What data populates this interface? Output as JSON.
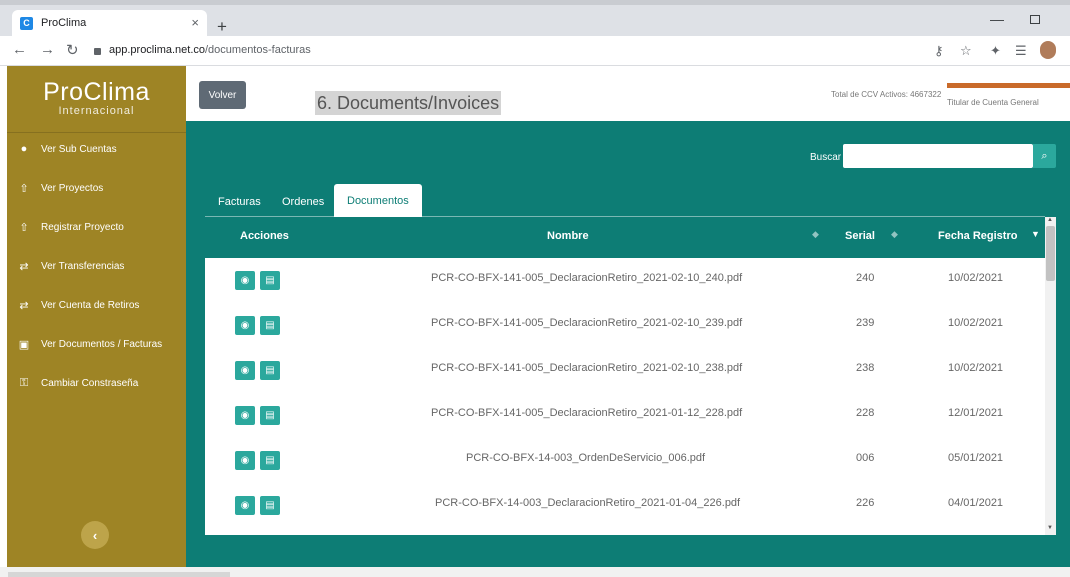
{
  "browser": {
    "tab_title": "ProClima",
    "tab_close": "×",
    "new_tab": "+",
    "url_domain": "app.proclima.net.co",
    "url_path": "/documentos-facturas"
  },
  "sidebar": {
    "logo_main": "ProClima",
    "logo_sub": "Internacional",
    "items": [
      {
        "label": "Ver Sub Cuentas",
        "icon": "group-icon"
      },
      {
        "label": "Ver Proyectos",
        "icon": "upload-icon"
      },
      {
        "label": "Registrar Proyecto",
        "icon": "upload-icon"
      },
      {
        "label": "Ver Transferencias",
        "icon": "transfer-icon"
      },
      {
        "label": "Ver Cuenta de Retiros",
        "icon": "transfer-icon"
      },
      {
        "label": "Ver Documentos / Facturas",
        "icon": "document-icon"
      },
      {
        "label": "Cambiar Constraseña",
        "icon": "key-icon"
      }
    ]
  },
  "header": {
    "back_label": "Volver",
    "title": "6. Documents/Invoices",
    "ccv_total": "Total de CCV Activos: 4667322",
    "user_role": "Titular de Cuenta General"
  },
  "search": {
    "label": "Buscar",
    "value": ""
  },
  "tabs": [
    {
      "label": "Facturas",
      "active": false
    },
    {
      "label": "Ordenes",
      "active": false
    },
    {
      "label": "Documentos",
      "active": true
    }
  ],
  "table": {
    "columns": [
      "Acciones",
      "Nombre",
      "Serial",
      "Fecha Registro"
    ],
    "rows": [
      {
        "nombre": "PCR-CO-BFX-141-005_DeclaracionRetiro_2021-02-10_240.pdf",
        "serial": "240",
        "fecha": "10/02/2021"
      },
      {
        "nombre": "PCR-CO-BFX-141-005_DeclaracionRetiro_2021-02-10_239.pdf",
        "serial": "239",
        "fecha": "10/02/2021"
      },
      {
        "nombre": "PCR-CO-BFX-141-005_DeclaracionRetiro_2021-02-10_238.pdf",
        "serial": "238",
        "fecha": "10/02/2021"
      },
      {
        "nombre": "PCR-CO-BFX-141-005_DeclaracionRetiro_2021-01-12_228.pdf",
        "serial": "228",
        "fecha": "12/01/2021"
      },
      {
        "nombre": "PCR-CO-BFX-14-003_OrdenDeServicio_006.pdf",
        "serial": "006",
        "fecha": "05/01/2021"
      },
      {
        "nombre": "PCR-CO-BFX-14-003_DeclaracionRetiro_2021-01-04_226.pdf",
        "serial": "226",
        "fecha": "04/01/2021"
      }
    ]
  },
  "colors": {
    "sidebar": "#9e8425",
    "teal": "#0d7d75",
    "action_button": "#2ba89d",
    "back_button": "#5f6a75"
  }
}
